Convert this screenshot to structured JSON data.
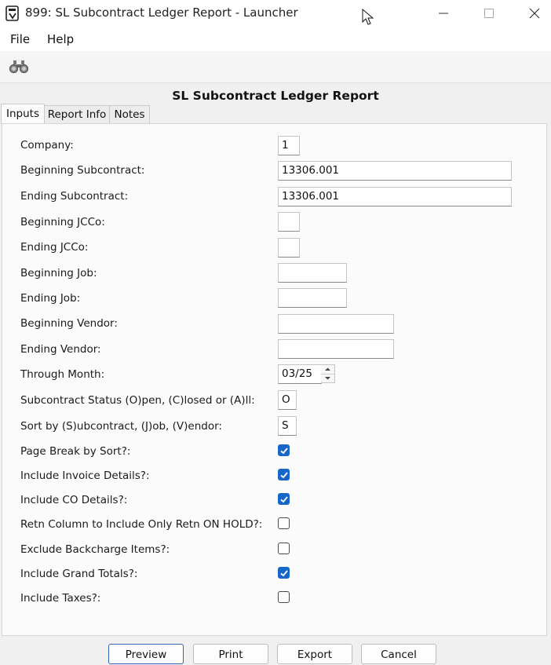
{
  "window": {
    "title": "899: SL Subcontract Ledger Report - Launcher",
    "icon": "launcher-app-icon",
    "controls": [
      "minimize-icon",
      "maximize-icon",
      "close-icon"
    ]
  },
  "menu": {
    "file": "File",
    "help": "Help"
  },
  "toolbar": {
    "icon": "binoculars-icon"
  },
  "report_title": "SL Subcontract Ledger Report",
  "tabs": [
    {
      "label": "Inputs",
      "active": true
    },
    {
      "label": "Report Info",
      "active": false
    },
    {
      "label": "Notes",
      "active": false
    }
  ],
  "inputs": {
    "company": {
      "label": "Company:",
      "value": "1"
    },
    "beg_subcontract": {
      "label": "Beginning Subcontract:",
      "value": "13306.001"
    },
    "end_subcontract": {
      "label": "Ending Subcontract:",
      "value": "13306.001"
    },
    "beg_jcco": {
      "label": "Beginning JCCo:",
      "value": ""
    },
    "end_jcco": {
      "label": "Ending JCCo:",
      "value": ""
    },
    "beg_job": {
      "label": "Beginning Job:",
      "value": ""
    },
    "end_job": {
      "label": "Ending Job:",
      "value": ""
    },
    "beg_vendor": {
      "label": "Beginning Vendor:",
      "value": ""
    },
    "end_vendor": {
      "label": "Ending Vendor:",
      "value": ""
    },
    "through_month": {
      "label": "Through Month:",
      "value": "03/25"
    },
    "status": {
      "label": "Subcontract Status (O)pen, (C)losed or (A)ll:",
      "value": "O"
    },
    "sort_by": {
      "label": "Sort by (S)ubcontract, (J)ob, (V)endor:",
      "value": "S"
    }
  },
  "checkboxes": [
    {
      "label": "Page Break by Sort?:",
      "checked": true
    },
    {
      "label": "Include Invoice Details?:",
      "checked": true
    },
    {
      "label": "Include CO Details?:",
      "checked": true
    },
    {
      "label": "Retn Column to Include Only Retn ON HOLD?:",
      "checked": false
    },
    {
      "label": "Exclude Backcharge Items?:",
      "checked": false
    },
    {
      "label": "Include Grand Totals?:",
      "checked": true
    },
    {
      "label": "Include Taxes?:",
      "checked": false
    }
  ],
  "buttons": {
    "preview": "Preview",
    "print": "Print",
    "export": "Export",
    "cancel": "Cancel"
  },
  "colors": {
    "accent": "#1667c7",
    "default_button_border": "#2f66b8"
  }
}
